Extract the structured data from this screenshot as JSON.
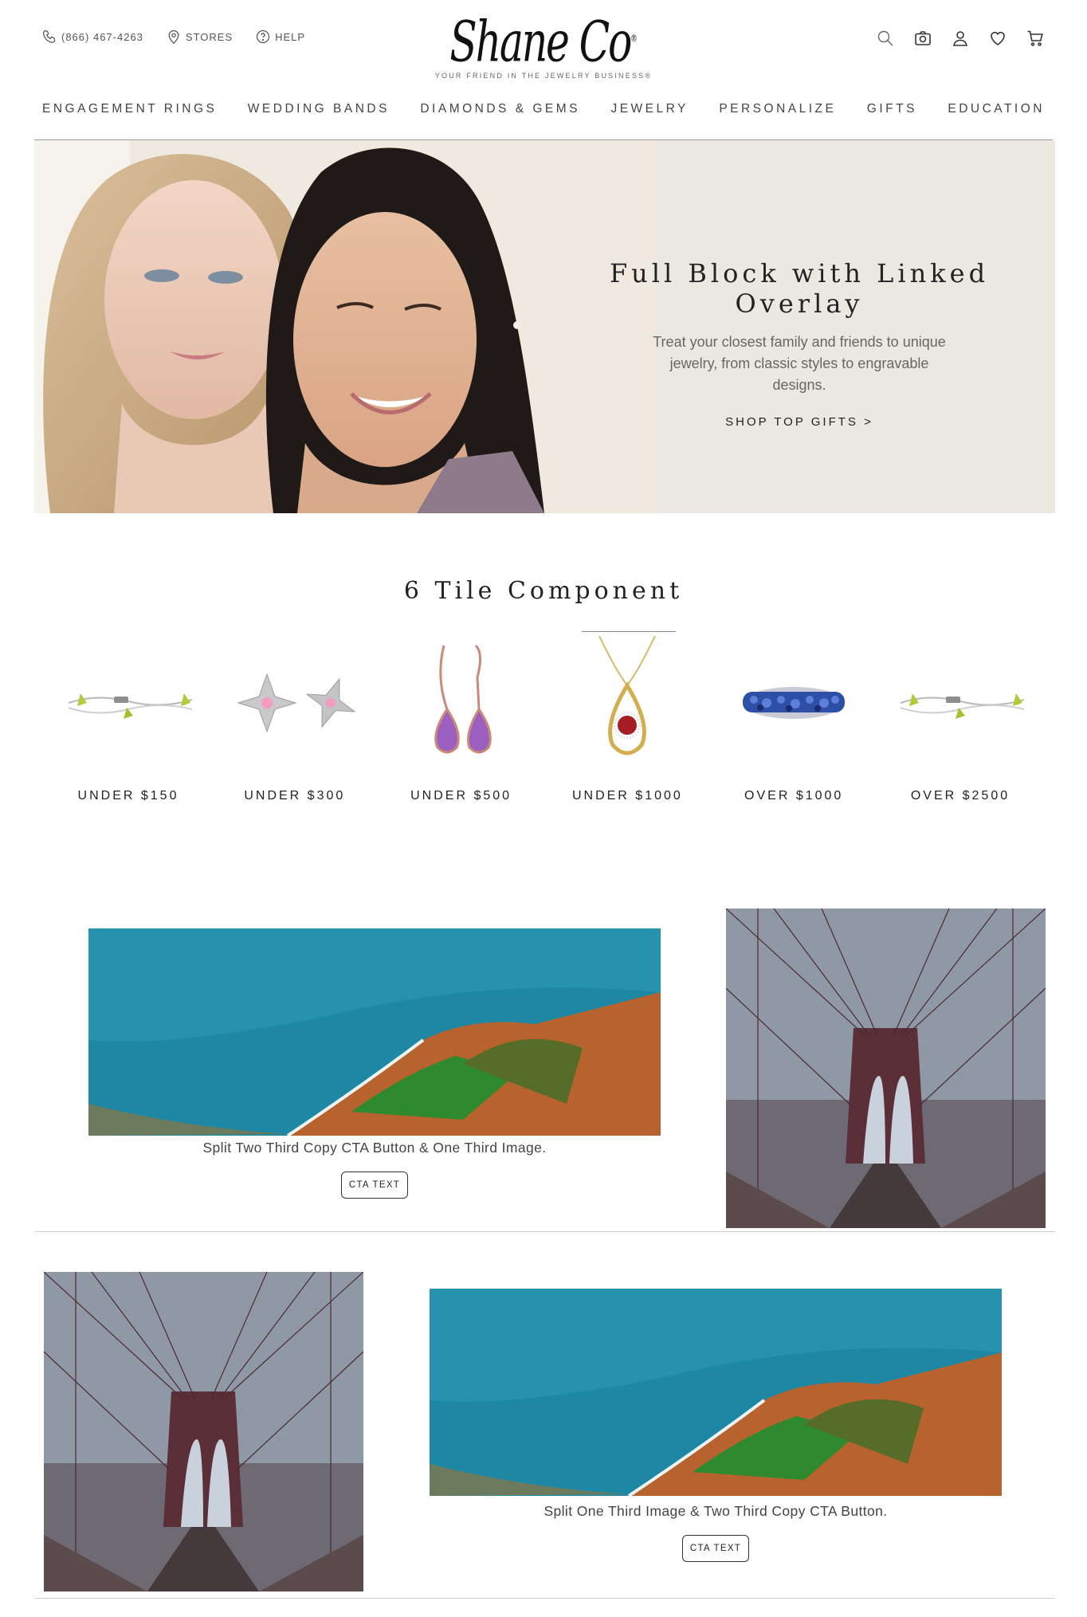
{
  "header": {
    "phone": "(866) 467-4263",
    "stores": "STORES",
    "help": "HELP",
    "logo_text": "Shane Co",
    "tagline": "YOUR FRIEND IN THE JEWELRY BUSINESS®",
    "icons": [
      "search-icon",
      "camera-icon",
      "account-icon",
      "wishlist-heart-icon",
      "cart-icon"
    ]
  },
  "nav": {
    "items": [
      {
        "label": "ENGAGEMENT RINGS"
      },
      {
        "label": "WEDDING BANDS"
      },
      {
        "label": "DIAMONDS & GEMS"
      },
      {
        "label": "JEWELRY"
      },
      {
        "label": "PERSONALIZE"
      },
      {
        "label": "GIFTS"
      },
      {
        "label": "EDUCATION"
      }
    ]
  },
  "hero": {
    "title": "Full Block with Linked Overlay",
    "body": "Treat your closest family and friends to unique jewelry, from classic styles to engravable designs.",
    "cta": "SHOP TOP GIFTS >"
  },
  "tiles": {
    "title": "6 Tile Component",
    "items": [
      {
        "label": "UNDER $150",
        "icon": "peridot-bracelet-icon"
      },
      {
        "label": "UNDER $300",
        "icon": "flower-earrings-icon"
      },
      {
        "label": "UNDER $500",
        "icon": "amethyst-drop-earrings-icon"
      },
      {
        "label": "UNDER $1000",
        "icon": "garnet-pendant-icon"
      },
      {
        "label": "OVER $1000",
        "icon": "sapphire-band-icon"
      },
      {
        "label": "OVER $2500",
        "icon": "peridot-bracelet-icon"
      }
    ]
  },
  "split_one": {
    "copy": "Split Two Third Copy CTA Button & One Third Image.",
    "cta": "CTA TEXT"
  },
  "split_two": {
    "copy": "Split One Third Image & Two Third Copy CTA Button.",
    "cta": "CTA TEXT"
  },
  "colors": {
    "hero_bg": "#ebe8e1",
    "text_dark": "#222222",
    "ocean": "#1f8aa5",
    "bridge": "#6a3b42"
  }
}
